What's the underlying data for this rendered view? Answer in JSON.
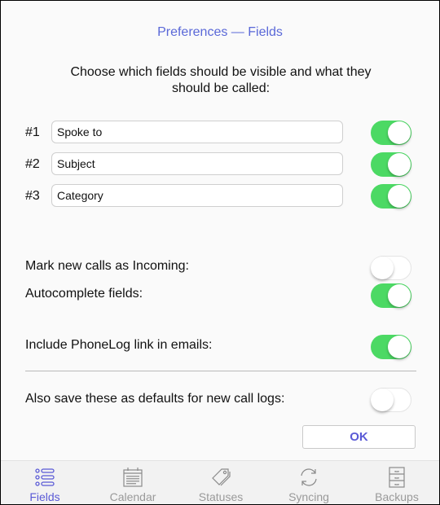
{
  "title": "Preferences — Fields",
  "intro": "Choose which fields should be visible and what they should be called:",
  "fields": [
    {
      "number": "#1",
      "value": "Spoke to",
      "visible": true
    },
    {
      "number": "#2",
      "value": "Subject",
      "visible": true
    },
    {
      "number": "#3",
      "value": "Category",
      "visible": true
    }
  ],
  "options": {
    "mark_incoming": {
      "label": "Mark new calls as Incoming:",
      "on": false
    },
    "autocomplete": {
      "label": "Autocomplete fields:",
      "on": true
    },
    "include_link": {
      "label": "Include PhoneLog link in emails:",
      "on": true
    },
    "save_defaults": {
      "label": "Also save these as defaults for new call logs:",
      "on": false
    }
  },
  "ok_label": "OK",
  "tabs": [
    {
      "label": "Fields",
      "icon": "list-icon",
      "active": true
    },
    {
      "label": "Calendar",
      "icon": "calendar-icon",
      "active": false
    },
    {
      "label": "Statuses",
      "icon": "tag-icon",
      "active": false
    },
    {
      "label": "Syncing",
      "icon": "sync-icon",
      "active": false
    },
    {
      "label": "Backups",
      "icon": "drawers-icon",
      "active": false
    }
  ],
  "colors": {
    "accent": "#5a68d8",
    "toggle_on": "#4cd964",
    "tab_inactive": "#9a9a9a"
  }
}
